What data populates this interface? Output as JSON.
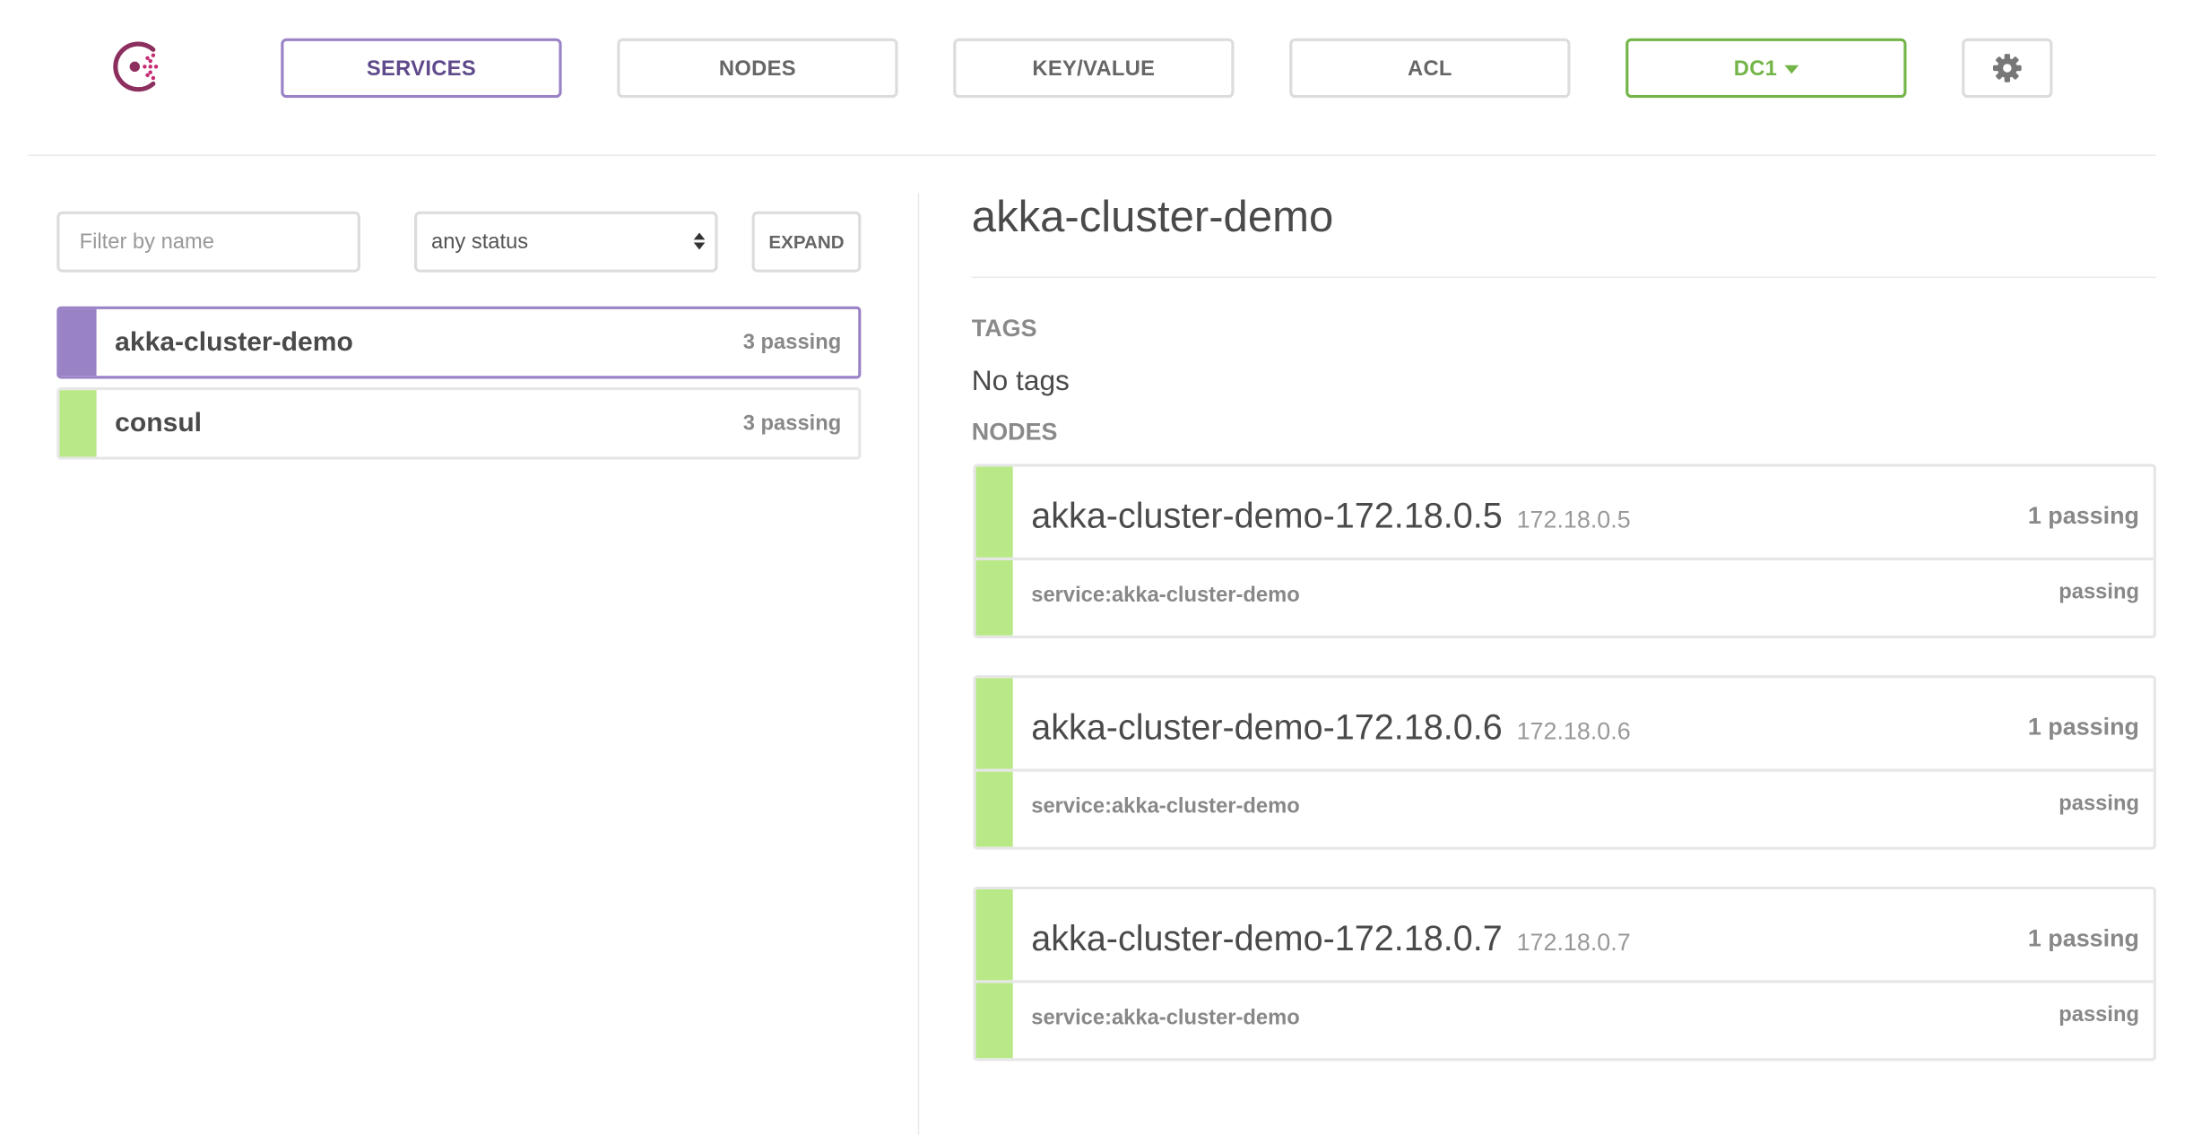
{
  "colors": {
    "accent_purple": "#9a82c6",
    "passing_green": "#b8e986",
    "datacenter_green": "#74b549",
    "logo_red": "#c62a71"
  },
  "header": {
    "logo_icon": "consul-logo-icon",
    "nav": [
      {
        "label": "SERVICES",
        "active": true
      },
      {
        "label": "NODES",
        "active": false
      },
      {
        "label": "KEY/VALUE",
        "active": false
      },
      {
        "label": "ACL",
        "active": false
      }
    ],
    "datacenter_label": "DC1",
    "settings_icon": "gear-icon"
  },
  "sidebar": {
    "filter_placeholder": "Filter by name",
    "filter_value": "",
    "status_selected": "any status",
    "expand_label": "EXPAND",
    "services": [
      {
        "name": "akka-cluster-demo",
        "status": "3 passing",
        "selected": true
      },
      {
        "name": "consul",
        "status": "3 passing",
        "selected": false
      }
    ]
  },
  "detail": {
    "title": "akka-cluster-demo",
    "tags_heading": "TAGS",
    "tags_value": "No tags",
    "nodes_heading": "NODES",
    "nodes": [
      {
        "name": "akka-cluster-demo-172.18.0.5",
        "address": "172.18.0.5",
        "status": "1 passing",
        "check": "service:akka-cluster-demo",
        "check_status": "passing"
      },
      {
        "name": "akka-cluster-demo-172.18.0.6",
        "address": "172.18.0.6",
        "status": "1 passing",
        "check": "service:akka-cluster-demo",
        "check_status": "passing"
      },
      {
        "name": "akka-cluster-demo-172.18.0.7",
        "address": "172.18.0.7",
        "status": "1 passing",
        "check": "service:akka-cluster-demo",
        "check_status": "passing"
      }
    ]
  }
}
